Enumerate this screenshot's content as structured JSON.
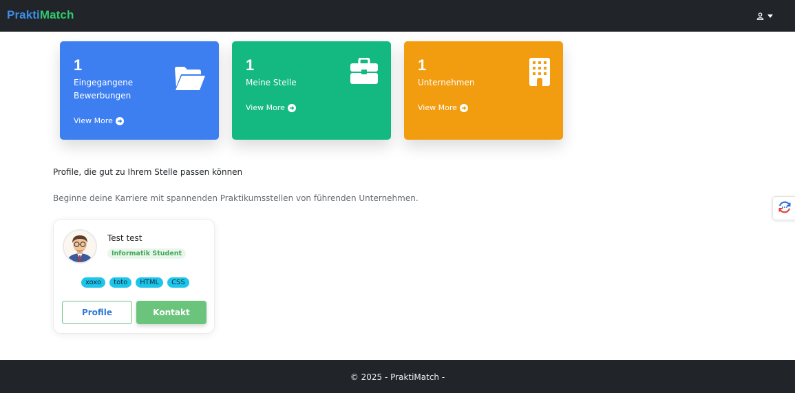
{
  "brand": {
    "part1": "Prakti",
    "part2": "Match"
  },
  "navbar": {
    "user_icon": "user-icon",
    "dropdown_icon": "caret-down-icon"
  },
  "cards": [
    {
      "count": "1",
      "label": "Eingegangene Bewerbungen",
      "link": "View More",
      "icon": "folder-open-icon",
      "color": "#3d7ff1"
    },
    {
      "count": "1",
      "label": "Meine Stelle",
      "link": "View More",
      "icon": "briefcase-icon",
      "color": "#13b981"
    },
    {
      "count": "1",
      "label": "Unternehmen",
      "link": "View More",
      "icon": "building-icon",
      "color": "#f29c0f"
    }
  ],
  "section": {
    "headline": "Profile, die gut zu Ihrem Stelle passen können",
    "subline": "Beginne deine Karriere mit spannenden Praktikumsstellen von führenden Unternehmen."
  },
  "profile": {
    "name": "Test test",
    "role": "Informatik Student",
    "tags": [
      "xoxo",
      "toto",
      "HTML",
      "CSS"
    ],
    "profile_button": "Profile",
    "contact_button": "Kontakt"
  },
  "footer": {
    "text": "© 2025 - PraktiMatch -"
  }
}
